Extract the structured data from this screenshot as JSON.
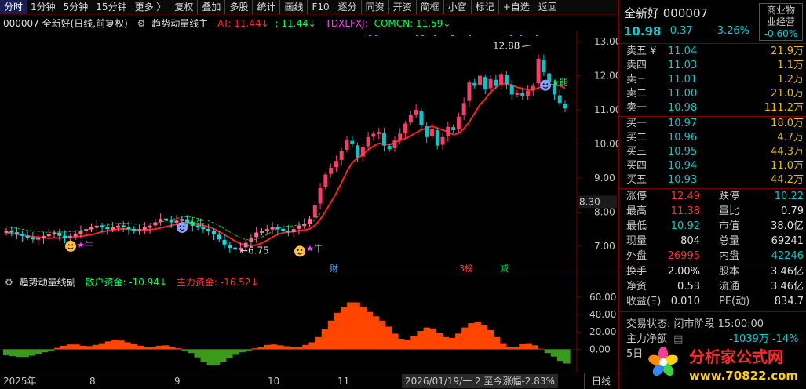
{
  "toolbar": {
    "tabs": [
      "分时",
      "1分钟",
      "5分钟",
      "15分钟",
      "更多 〉"
    ],
    "buttons": [
      "复权",
      "叠加",
      "多股",
      "统计",
      "画线",
      "F10",
      "逐分",
      "同资",
      "开资",
      "简框",
      "小窗",
      "标记",
      "+自选",
      "返回"
    ]
  },
  "main_info": {
    "code_title": "000007 全新好(日线,前复权)",
    "indicator": "趋势动量线主",
    "at": "AT: 11.44↓",
    "at2": ": 11.44↓",
    "tdx": "TDXLFXJ:",
    "com": "COMCN: 11.59↓"
  },
  "sub_info": {
    "indicator": "趋势动量线副",
    "retail": "散户资金: -10.94↓",
    "main": "主力资金: -16.52↓"
  },
  "chart_data": [
    {
      "type": "candlestick",
      "title": "000007 全新好(日线,前复权)",
      "y_ticks": [
        7.0,
        8.0,
        9.0,
        10.0,
        11.0,
        12.0,
        13.0
      ],
      "ylim": [
        6.4,
        13.3
      ],
      "current_price_label": "8.30",
      "annotations": {
        "high": "12.88",
        "low": "←6.75",
        "markers": [
          "★牛",
          "★能",
          "★牛",
          "财",
          "3榜",
          "减"
        ]
      },
      "x_ticks": [
        "2025年",
        "8",
        "9",
        "10",
        "11"
      ],
      "candles_close_approx": [
        7.45,
        7.4,
        7.35,
        7.3,
        7.25,
        7.2,
        7.25,
        7.3,
        7.35,
        7.4,
        7.3,
        7.25,
        7.3,
        7.35,
        7.45,
        7.5,
        7.55,
        7.6,
        7.55,
        7.5,
        7.55,
        7.6,
        7.55,
        7.5,
        7.45,
        7.5,
        7.55,
        7.6,
        7.7,
        7.8,
        7.75,
        7.7,
        7.75,
        7.8,
        7.7,
        7.6,
        7.55,
        7.5,
        7.45,
        7.35,
        7.2,
        7.05,
        6.95,
        6.9,
        6.95,
        7.1,
        7.25,
        7.4,
        7.45,
        7.5,
        7.55,
        7.5,
        7.45,
        7.4,
        7.5,
        7.6,
        7.65,
        7.8,
        8.2,
        8.7,
        9.1,
        9.3,
        9.5,
        9.8,
        10.1,
        10.0,
        9.6,
        9.9,
        10.2,
        10.3,
        10.35,
        9.95,
        9.85,
        10.1,
        10.3,
        10.6,
        10.85,
        11.0,
        10.55,
        10.2,
        10.45,
        9.95,
        10.2,
        10.5,
        10.4,
        10.8,
        11.2,
        11.8,
        11.7,
        12.0,
        11.6,
        11.9,
        11.7,
        12.05,
        11.75,
        11.45,
        11.5,
        11.4,
        11.55,
        11.7,
        12.5,
        12.1,
        11.8,
        11.45,
        11.2,
        11.04
      ],
      "series": [
        {
          "name": "AT",
          "values_end": 11.44,
          "color": "#ff2020"
        },
        {
          "name": "COMCN",
          "values_end": 11.59,
          "color": "#00ff00"
        }
      ]
    },
    {
      "type": "area",
      "title": "趋势动量线副",
      "y_ticks": [
        0.0,
        20.0,
        40.0,
        60.0
      ],
      "ylim": [
        -25,
        68
      ],
      "series": [
        {
          "name": "散户资金",
          "last": -10.94
        },
        {
          "name": "主力资金",
          "last": -16.52
        }
      ],
      "values_approx": [
        -6,
        -7,
        -8,
        -9,
        -8,
        -6,
        -4,
        -2,
        0,
        3,
        5,
        6,
        5,
        3,
        4,
        6,
        8,
        10,
        11,
        9,
        7,
        5,
        3,
        2,
        3,
        5,
        4,
        2,
        0,
        -2,
        -6,
        -12,
        -17,
        -19,
        -16,
        -12,
        -8,
        -4,
        -2,
        0,
        2,
        4,
        6,
        5,
        4,
        3,
        2,
        4,
        6,
        10,
        18,
        28,
        38,
        46,
        52,
        56,
        52,
        46,
        40,
        36,
        30,
        22,
        14,
        10,
        12,
        18,
        24,
        26,
        22,
        16,
        12,
        14,
        22,
        28,
        32,
        30,
        26,
        18,
        10,
        4,
        2,
        4,
        8,
        6,
        3,
        -2,
        -6,
        -10,
        -16
      ]
    }
  ],
  "bottom": {
    "x_labels": [
      "2025年",
      "8",
      "9",
      "10",
      "11"
    ],
    "status": "2026/01/19/一 2 至今涨幅-2.83%",
    "daybtn": "日线"
  },
  "panel": {
    "name": "全新好 000007",
    "price": "10.98",
    "change": "-0.37",
    "pct": "-3.26%",
    "industry": "商业物业经营",
    "industry_pct": "-0.60%",
    "sell": [
      {
        "k": "卖五 ¥",
        "p": "11.04",
        "v": "21.9万"
      },
      {
        "k": "卖四",
        "p": "11.03",
        "v": "1.1万"
      },
      {
        "k": "卖三",
        "p": "11.01",
        "v": "1.2万"
      },
      {
        "k": "卖二",
        "p": "11.00",
        "v": "21.0万"
      },
      {
        "k": "卖一",
        "p": "10.98",
        "v": "111.2万"
      }
    ],
    "buy": [
      {
        "k": "买一",
        "p": "10.97",
        "v": "18.0万"
      },
      {
        "k": "买二",
        "p": "10.96",
        "v": "4.7万"
      },
      {
        "k": "买三",
        "p": "10.95",
        "v": "44.3万"
      },
      {
        "k": "买四",
        "p": "10.94",
        "v": "11.0万"
      },
      {
        "k": "买五",
        "p": "10.93",
        "v": "44.2万"
      }
    ],
    "stats1": [
      {
        "k1": "涨停",
        "v1": "12.49",
        "k2": "跌停",
        "v2": "10.22"
      },
      {
        "k1": "最高",
        "v1": "11.38",
        "k2": "量比",
        "v2": "0.79"
      },
      {
        "k1": "最低",
        "v1": "10.92",
        "k2": "市值",
        "v2": "38.0亿"
      },
      {
        "k1": "现量",
        "v1": "804",
        "k2": "总量",
        "v2": "69241"
      },
      {
        "k1": "外盘",
        "v1": "26995",
        "k2": "内盘",
        "v2": "42246"
      }
    ],
    "stats2": [
      {
        "k1": "换手",
        "v1": "2.00%",
        "k2": "股本",
        "v2": "3.46亿"
      },
      {
        "k1": "净资",
        "v1": "0.53",
        "k2": "流通",
        "v2": "3.46亿"
      },
      {
        "k1": "收益(Ξ)",
        "v1": "0.010",
        "k2": "PE(动)",
        "v2": "834.7"
      }
    ],
    "trade_state": "交易状态: 闭市阶段 15:00:00",
    "main_flow_label": "主力净额",
    "main_flow_value": "-1039万 -14%",
    "five_day": "5日",
    "logo_text": "分析家公式网",
    "logo_url": "www.70822.com"
  },
  "colors": {
    "up": "#ff3030",
    "down": "#00d0d0",
    "accent_red": "#7a0000",
    "ma": "#ff2020",
    "orange_area": "#ff4500",
    "green_area": "#3a9a1a"
  }
}
